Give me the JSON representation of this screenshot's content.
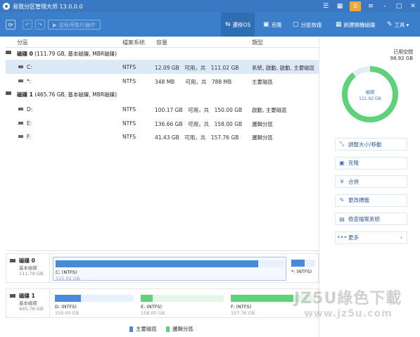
{
  "app": {
    "title": "易我分区管理大师 13.0.0.0"
  },
  "titlebar_icons": [
    "list-icon",
    "grid-icon",
    "key-icon",
    "menu-icon",
    "minimize-icon",
    "maximize-icon",
    "close-icon"
  ],
  "toolbar": {
    "pending_label": "▶ 沒有待執行操作",
    "tools": [
      {
        "label": "遷移OS",
        "icon": "migrate-icon"
      },
      {
        "label": "克隆",
        "icon": "clone-icon"
      },
      {
        "label": "分區恢復",
        "icon": "recovery-icon"
      },
      {
        "label": "創建開機磁碟",
        "icon": "bootdisk-icon"
      },
      {
        "label": "工具",
        "icon": "tools-icon"
      }
    ]
  },
  "table": {
    "headers": [
      "分區",
      "檔案系統",
      "容量",
      "類型"
    ],
    "disk0": {
      "name": "磁碟 0",
      "info": "(111.79 GB, 基本磁碟, MBR磁碟)"
    },
    "disk0_parts": [
      {
        "name": "C:",
        "fs": "NTFS",
        "cap": "12.09 GB　可用，共　111.02 GB",
        "type": "系統, 啟動, 啟動, 主要磁區"
      },
      {
        "name": "*:",
        "fs": "NTFS",
        "cap": "348 MB　　可用，共　788 MB",
        "type": "主要磁區"
      }
    ],
    "disk1": {
      "name": "磁碟 1",
      "info": "(465.76 GB, 基本磁碟, MBR磁碟)"
    },
    "disk1_parts": [
      {
        "name": "D:",
        "fs": "NTFS",
        "cap": "100.17 GB　可用，共　150.00 GB",
        "type": "啟動, 主要磁區"
      },
      {
        "name": "E:",
        "fs": "NTFS",
        "cap": "136.66 GB　可用，共　158.00 GB",
        "type": "邏輯分區"
      },
      {
        "name": "F:",
        "fs": "NTFS",
        "cap": "41.43 GB　可用，共　157.76 GB",
        "type": "邏輯分區"
      }
    ]
  },
  "diskmap": {
    "d0": {
      "name": "磁碟 0",
      "type": "基本磁碟",
      "size": "111.79 GB",
      "parts": [
        {
          "name": "C: (NTFS)",
          "size": "111.02 GB",
          "used": 0.89
        },
        {
          "name": "*: (NTFS)",
          "size": "",
          "used": 0.56
        }
      ]
    },
    "d1": {
      "name": "磁碟 1",
      "type": "基本磁碟",
      "size": "465.76 GB",
      "parts": [
        {
          "name": "D: (NTFS)",
          "size": "150.00 GB",
          "used": 0.33
        },
        {
          "name": "E: (NTFS)",
          "size": "158.00 GB",
          "used": 0.14
        },
        {
          "name": "F: (NTFS)",
          "size": "157.76 GB",
          "used": 0.74
        }
      ]
    }
  },
  "legend": {
    "primary": "主要磁區",
    "logical": "邏輯分區",
    "primary_color": "#4a8ad9",
    "logical_color": "#5fd17a"
  },
  "right": {
    "used_label": "已用空間",
    "used_value": "98.92 GB",
    "ring_name": "磁碟",
    "ring_size": "111.02 GB",
    "used_fraction": 0.89,
    "actions": [
      {
        "label": "調整大小/移動",
        "icon": "resize-icon"
      },
      {
        "label": "克隆",
        "icon": "clone-icon"
      },
      {
        "label": "合併",
        "icon": "merge-icon"
      },
      {
        "label": "更改標籤",
        "icon": "label-icon"
      },
      {
        "label": "檢查檔案系統",
        "icon": "check-icon"
      },
      {
        "label": "更多",
        "icon": "more-icon"
      }
    ]
  },
  "watermark": {
    "line1": "JZ5U綠色下載",
    "line2": "www.jz5u.com"
  }
}
